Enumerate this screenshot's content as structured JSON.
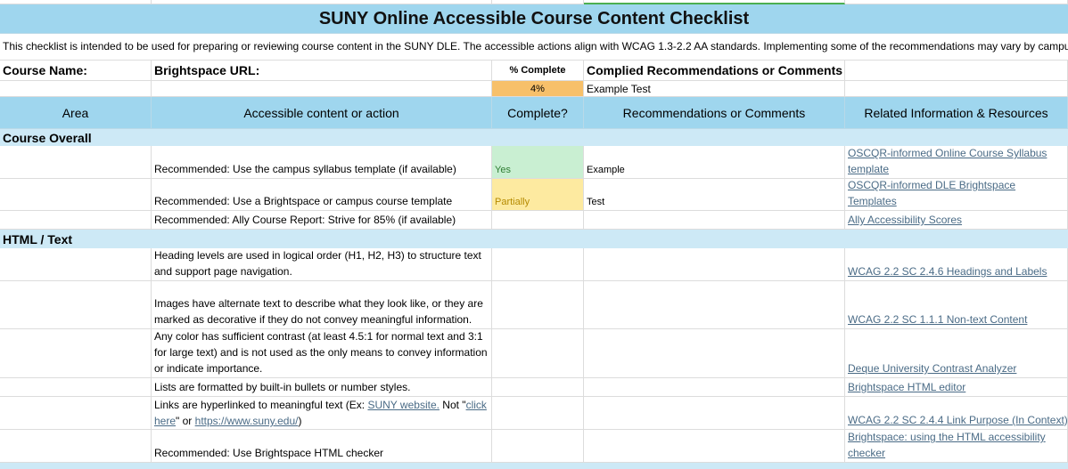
{
  "title": "SUNY Online Accessible Course Content Checklist",
  "intro": "This checklist is intended to be used for preparing or reviewing course content in the SUNY DLE. The accessible actions align with WCAG 1.3-2.2 AA standards. Implementing some of the recommendations may vary by campus",
  "course_info": {
    "course_name_label": "Course Name:",
    "brightspace_url_label": "Brightspace URL:",
    "percent_label": "% Complete",
    "comments_label": "Complied Recommendations or Comments",
    "percent_value": "4%",
    "comments_value": "Example Test"
  },
  "headers": {
    "area": "Area",
    "content": "Accessible content or action",
    "complete": "Complete?",
    "recommendations": "Recommendations or Comments",
    "resources": "Related Information & Resources"
  },
  "sections": {
    "course_overall": "Course Overall",
    "html_text": "HTML / Text"
  },
  "course_rows": [
    {
      "content": "Recommended: Use the campus syllabus template (if available)",
      "complete": "Yes",
      "comment": "Example",
      "resource": "OSCQR-informed Online Course Syllabus template"
    },
    {
      "content": "Recommended: Use a Brightspace or campus course template",
      "complete": "Partially",
      "comment": "Test",
      "resource": "OSCQR-informed DLE Brightspace Templates"
    },
    {
      "content": "Recommended: Ally Course Report: Strive for 85% (if available)",
      "complete": "",
      "comment": "",
      "resource": "Ally Accessibility Scores"
    }
  ],
  "html_rows": [
    {
      "content": "Heading levels are used in logical order (H1, H2, H3)  to structure text and support page navigation.",
      "resource": "WCAG 2.2 SC 2.4.6 Headings and Labels"
    },
    {
      "content": "Images have alternate text to describe what they look like, or they are marked as decorative if they do not convey meaningful information.",
      "resource": "WCAG 2.2 SC 1.1.1 Non-text Content"
    },
    {
      "content": "Any color has sufficient contrast (at least 4.5:1 for normal text and 3:1 for large text) and is not used as the only means to convey information or indicate importance.",
      "resource": "Deque University Contrast Analyzer"
    },
    {
      "content": "Lists are formatted by built-in bullets or number styles.",
      "resource": "Brightspace HTML editor"
    },
    {
      "content_pre": "Links are hyperlinked to meaningful text (Ex: ",
      "content_link1": "SUNY website.",
      "content_mid": " Not \"",
      "content_link2": "click here",
      "content_mid2": "\" or ",
      "content_link3": "https://www.suny.edu/",
      "content_post": ")",
      "resource": "WCAG 2.2 SC 2.4.4 Link Purpose (In Context)"
    },
    {
      "content": "Recommended: Use Brightspace HTML checker",
      "resource": "Brightspace: using the HTML accessibility checker"
    }
  ],
  "colors": {
    "title_bg": "#9fd6ee",
    "section_bg": "#cde9f6",
    "percent_bg": "#f7c06a",
    "yes_bg": "#c9efd2",
    "yes_text": "#2e7d32",
    "partial_bg": "#fdeaa0",
    "partial_text": "#b58a00",
    "link": "#4a6b86"
  }
}
